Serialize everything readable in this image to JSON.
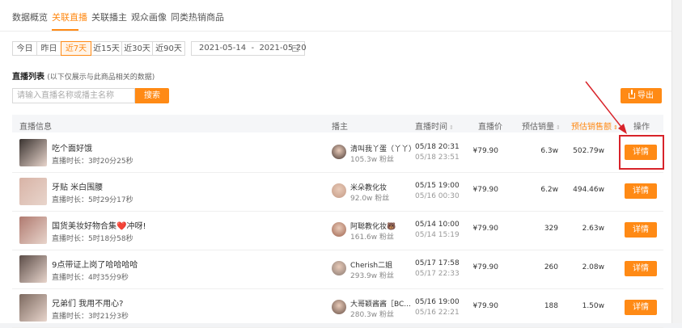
{
  "tabs": [
    "数据概览",
    "关联直播",
    "关联播主",
    "观众画像",
    "同类热销商品"
  ],
  "active_tab": "关联直播",
  "date_buttons": [
    "今日",
    "昨日",
    "近7天",
    "近15天",
    "近30天",
    "近90天"
  ],
  "active_date": "近7天",
  "date_range": "2021-05-14  -  2021-05-20",
  "section": {
    "title": "直播列表",
    "note": "(以下仅展示与此商品相关的数据)"
  },
  "search": {
    "placeholder": "请输入直播名称或播主名称",
    "button_label": "搜索"
  },
  "export_label": "导出",
  "table": {
    "headers": {
      "live": "直播信息",
      "anchor": "播主",
      "time": "直播时间",
      "price": "直播价",
      "sales": "预估销量",
      "gmv": "预估销售额",
      "action": "操作"
    },
    "detail_label": "详情",
    "rows": [
      {
        "title": "吃个面好饿",
        "duration": "直播时长：3时20分25秒",
        "anchor": "清叫我丫蛋（丫丫）",
        "fans": "105.3w 粉丝",
        "start": "05/18 20:31",
        "end": "05/18 23:51",
        "price": "¥79.90",
        "sales": "6.3w",
        "gmv": "502.79w",
        "thumb_color": "#3a3330",
        "avatar_color": "#4a3a35"
      },
      {
        "title": "牙贴 米白围腰",
        "duration": "直播时长：5时29分17秒",
        "anchor": "米朵教化妆",
        "fans": "92.0w 粉丝",
        "start": "05/15 19:00",
        "end": "05/16 00:30",
        "price": "¥79.90",
        "sales": "6.2w",
        "gmv": "494.46w",
        "thumb_color": "#d8b3a6",
        "avatar_color": "#c49a85"
      },
      {
        "title": "国货美妆好物合集❤️冲呀!",
        "duration": "直播时长：5时18分58秒",
        "anchor": "阿聪教化妆🐻",
        "fans": "161.6w 粉丝",
        "start": "05/14 10:00",
        "end": "05/14 15:19",
        "price": "¥79.90",
        "sales": "329",
        "gmv": "2.63w",
        "thumb_color": "#b07a70",
        "avatar_color": "#a06550"
      },
      {
        "title": "9点带证上岗了哈哈哈哈",
        "duration": "直播时长：4时35分9秒",
        "anchor": "Cherish二姐",
        "fans": "293.9w 粉丝",
        "start": "05/17 17:58",
        "end": "05/17 22:33",
        "price": "¥79.90",
        "sales": "260",
        "gmv": "2.08w",
        "thumb_color": "#5c4d48",
        "avatar_color": "#8a7a72"
      },
      {
        "title": "兄弟们 我用不用心?",
        "duration": "直播时长：3时21分3秒",
        "anchor": "大哥颖酱酱［BC...",
        "fans": "280.3w 粉丝",
        "start": "05/16 19:00",
        "end": "05/16 22:21",
        "price": "¥79.90",
        "sales": "188",
        "gmv": "1.50w",
        "thumb_color": "#7d6a60",
        "avatar_color": "#6a5248"
      }
    ]
  }
}
